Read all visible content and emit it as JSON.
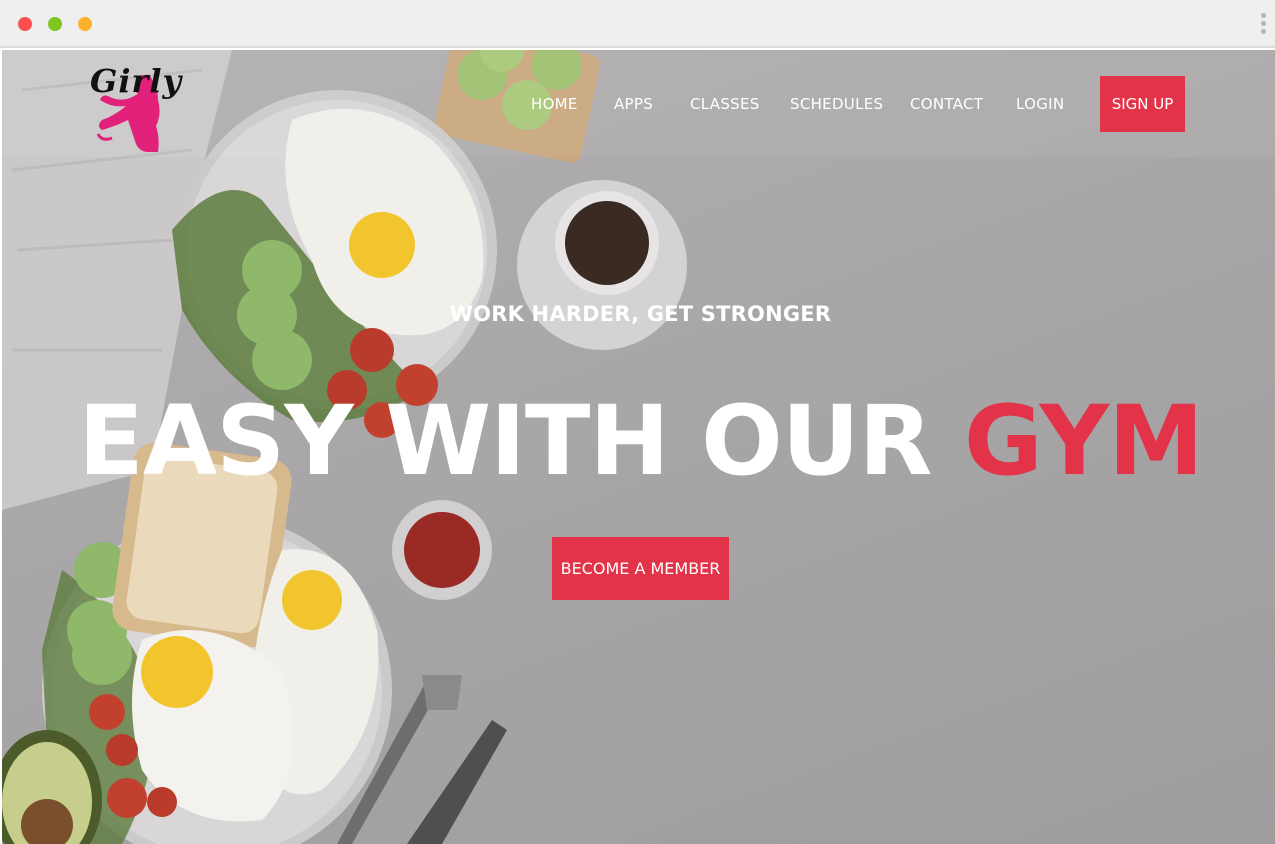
{
  "browser": {
    "controls": [
      "close",
      "minimize",
      "maximize"
    ],
    "menu_icon": "more-vert-icon"
  },
  "brand": {
    "logo_text": "Girly",
    "logo_icon": "dancer-silhouette-icon",
    "accent_color": "#e23349"
  },
  "nav": {
    "items": [
      {
        "label": "HOME"
      },
      {
        "label": "APPS"
      },
      {
        "label": "CLASSES"
      },
      {
        "label": "SCHEDULES"
      },
      {
        "label": "CONTACT"
      },
      {
        "label": "LOGIN"
      }
    ],
    "signup_label": "SIGN UP"
  },
  "hero": {
    "tagline": "WORK HARDER, GET STRONGER",
    "headline_main": "EASY WITH OUR ",
    "headline_accent": "GYM",
    "cta_label": "BECOME A MEMBER"
  }
}
